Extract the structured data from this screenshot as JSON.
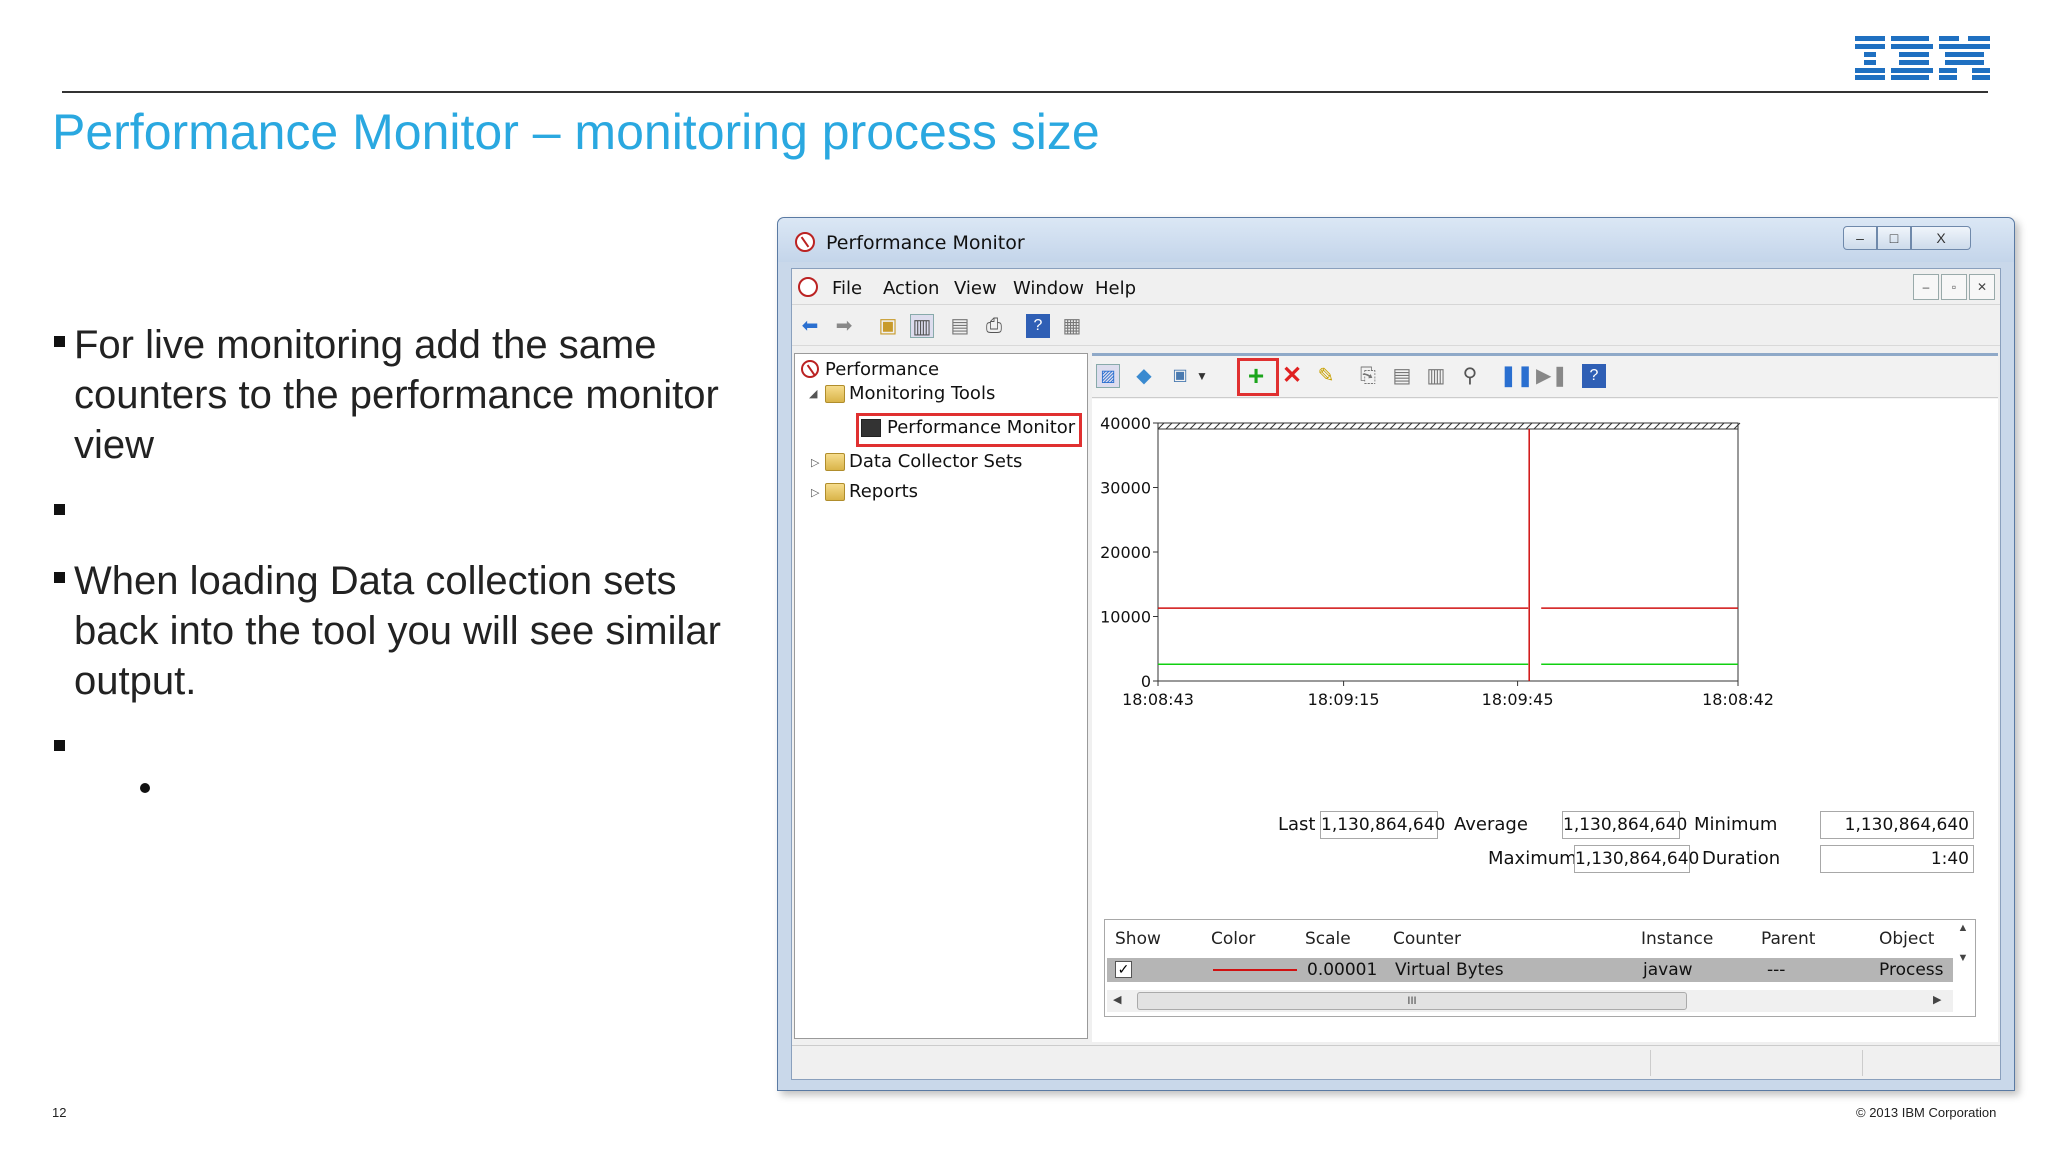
{
  "slide": {
    "logo": "IBM",
    "title": "Performance Monitor – monitoring process size",
    "bullets": [
      "For live monitoring add the same counters to the performance monitor view",
      "",
      "When loading Data collection sets back into the tool you will see similar output.",
      ""
    ],
    "page_number": "12",
    "copyright": "© 2013 IBM Corporation"
  },
  "window": {
    "title": "Performance Monitor",
    "controls": {
      "minimize": "–",
      "maximize": "□",
      "close": "X"
    },
    "menu": [
      "File",
      "Action",
      "View",
      "Window",
      "Help"
    ]
  },
  "tree": {
    "root": "Performance",
    "items": [
      "Monitoring Tools",
      "Performance Monitor",
      "Data Collector Sets",
      "Reports"
    ]
  },
  "accent_colors": {
    "highlight_box": "#e03030",
    "series_red": "#d01010",
    "series_green": "#10d010",
    "title_blue": "#2aa8e0"
  },
  "chart_data": {
    "type": "line",
    "x_ticks": [
      "18:08:43",
      "18:09:15",
      "18:09:45",
      "18:08:42"
    ],
    "y_ticks": [
      "0",
      "10000",
      "20000",
      "30000",
      "40000"
    ],
    "ylim": [
      0,
      40000
    ],
    "series": [
      {
        "color": "#d01010",
        "values": [
          11300,
          11300
        ]
      },
      {
        "color": "#10d010",
        "values": [
          2600,
          2600
        ]
      }
    ]
  },
  "stats": {
    "last_label": "Last",
    "last": "1,130,864,640",
    "average_label": "Average",
    "average": "1,130,864,640",
    "minimum_label": "Minimum",
    "minimum": "1,130,864,640",
    "maximum_label": "Maximum",
    "maximum": "1,130,864,640",
    "duration_label": "Duration",
    "duration": "1:40"
  },
  "legend": {
    "headers": [
      "Show",
      "Color",
      "Scale",
      "Counter",
      "Instance",
      "Parent",
      "Object"
    ],
    "row": {
      "scale": "0.00001",
      "counter": "Virtual Bytes",
      "instance": "javaw",
      "parent": "---",
      "object": "Process"
    },
    "scroll_thumb": "III"
  }
}
